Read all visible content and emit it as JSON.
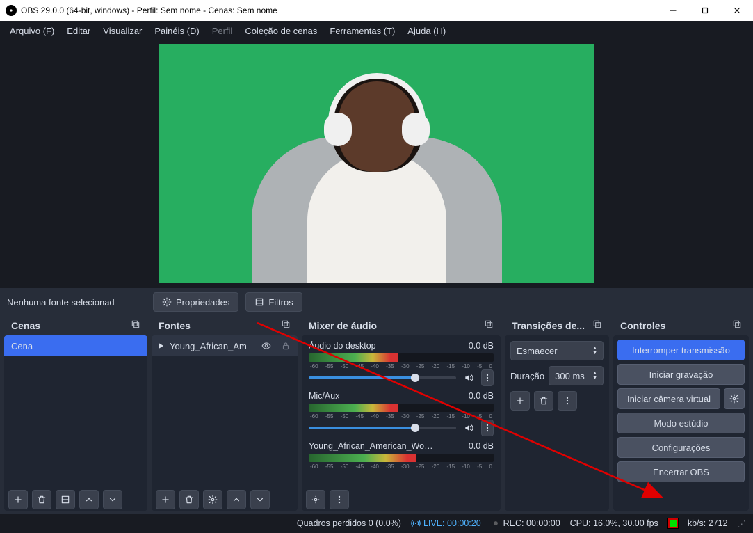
{
  "titlebar": {
    "title": "OBS 29.0.0 (64-bit, windows) - Perfil: Sem nome - Cenas: Sem nome"
  },
  "menubar": {
    "items": [
      "Arquivo (F)",
      "Editar",
      "Visualizar",
      "Painéis (D)",
      "Perfil",
      "Coleção de cenas",
      "Ferramentas (T)",
      "Ajuda (H)"
    ],
    "dim_index": 4
  },
  "srcrow": {
    "no_source": "Nenhuma fonte selecionad",
    "properties": "Propriedades",
    "filters": "Filtros"
  },
  "scenes": {
    "title": "Cenas",
    "items": [
      "Cena"
    ]
  },
  "sources": {
    "title": "Fontes",
    "items": [
      {
        "name": "Young_African_Am"
      }
    ]
  },
  "mixer": {
    "title": "Mixer de áudio",
    "ticks": [
      "-60",
      "-55",
      "-50",
      "-45",
      "-40",
      "-35",
      "-30",
      "-25",
      "-20",
      "-15",
      "-10",
      "-5",
      "0"
    ],
    "channels": [
      {
        "name": "Áudio do desktop",
        "db": "0.0 dB",
        "level": 48,
        "vol": 72
      },
      {
        "name": "Mic/Aux",
        "db": "0.0 dB",
        "level": 48,
        "vol": 72
      },
      {
        "name": "Young_African_American_Woman_He",
        "db": "0.0 dB",
        "level": 58,
        "vol": 72,
        "compact": true
      }
    ]
  },
  "trans": {
    "title": "Transições de...",
    "selected": "Esmaecer",
    "duration_label": "Duração",
    "duration": "300 ms"
  },
  "controls": {
    "title": "Controles",
    "stop_stream": "Interromper transmissão",
    "start_record": "Iniciar gravação",
    "start_vcam": "Iniciar câmera virtual",
    "studio": "Modo estúdio",
    "settings": "Configurações",
    "exit": "Encerrar OBS"
  },
  "status": {
    "dropped": "Quadros perdidos 0 (0.0%)",
    "live": "LIVE: 00:00:20",
    "rec": "REC: 00:00:00",
    "cpu": "CPU: 16.0%, 30.00 fps",
    "bitrate": "kb/s: 2712"
  }
}
